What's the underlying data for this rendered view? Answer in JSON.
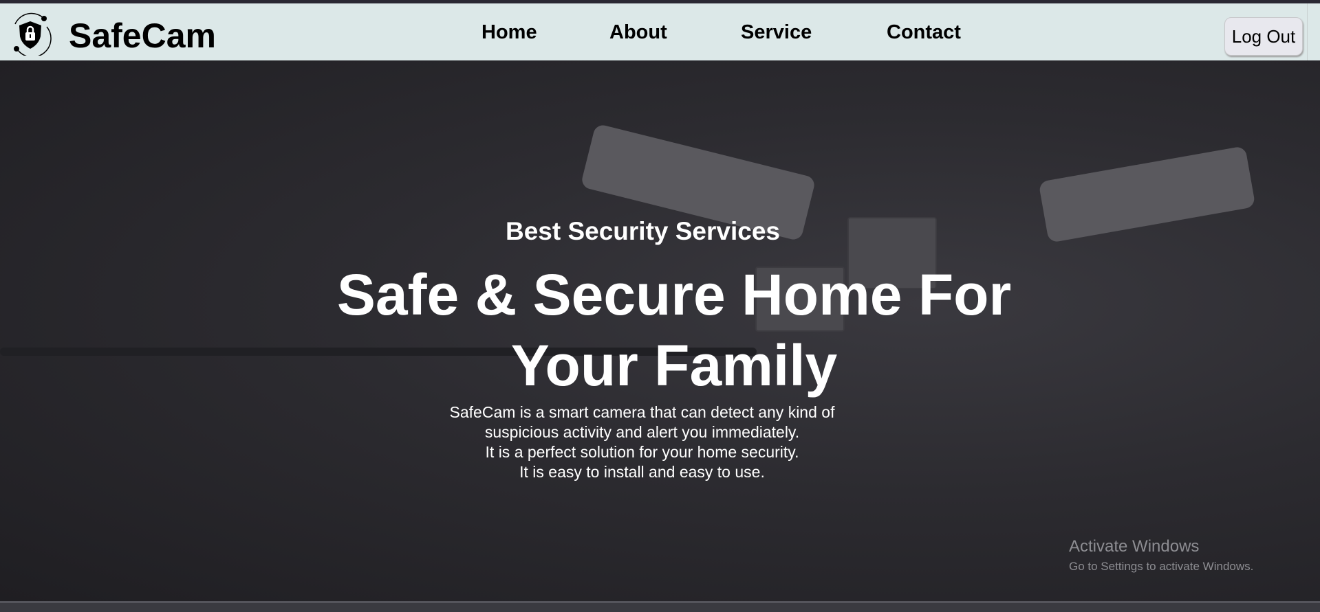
{
  "header": {
    "brand": "SafeCam",
    "logo_icon": "shield-lock-icon",
    "nav": [
      {
        "label": "Home"
      },
      {
        "label": "About"
      },
      {
        "label": "Service"
      },
      {
        "label": "Contact"
      }
    ],
    "logout_label": "Log Out"
  },
  "hero": {
    "subtitle": "Best Security Services",
    "title_line1": "Safe & Secure Home For",
    "title_line2": "Your Family",
    "description": [
      "SafeCam is a smart camera that can detect any kind of",
      "suspicious activity and alert you immediately.",
      "It is a perfect solution for your home security.",
      "It is easy to install and easy to use."
    ]
  },
  "watermark": {
    "title": "Activate Windows",
    "subtitle": "Go to Settings to activate Windows."
  }
}
